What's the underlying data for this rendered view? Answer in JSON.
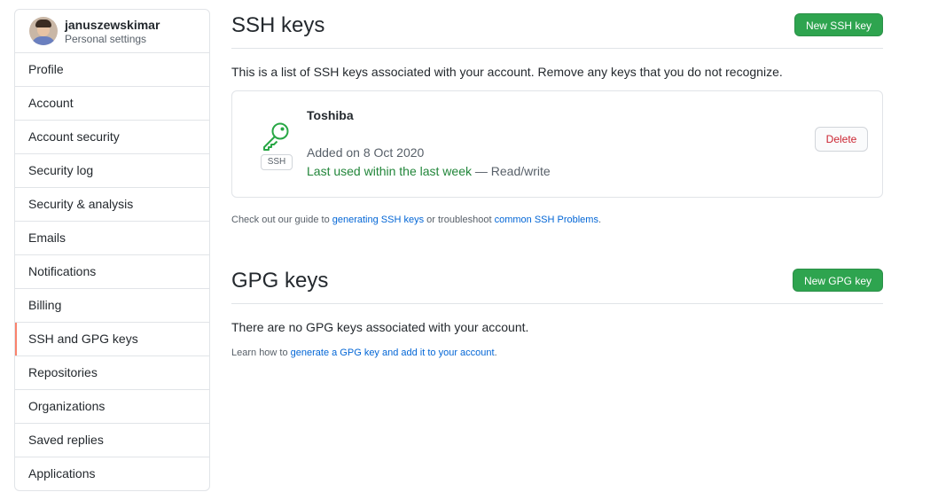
{
  "user": {
    "username": "januszewskimar",
    "subtitle": "Personal settings"
  },
  "sidebar": {
    "items": [
      {
        "label": "Profile"
      },
      {
        "label": "Account"
      },
      {
        "label": "Account security"
      },
      {
        "label": "Security log"
      },
      {
        "label": "Security & analysis"
      },
      {
        "label": "Emails"
      },
      {
        "label": "Notifications"
      },
      {
        "label": "Billing"
      },
      {
        "label": "SSH and GPG keys",
        "selected": true
      },
      {
        "label": "Repositories"
      },
      {
        "label": "Organizations"
      },
      {
        "label": "Saved replies"
      },
      {
        "label": "Applications"
      }
    ]
  },
  "ssh": {
    "title": "SSH keys",
    "new_button": "New SSH key",
    "description": "This is a list of SSH keys associated with your account. Remove any keys that you do not recognize.",
    "key": {
      "icon": "key-icon",
      "type_label": "SSH",
      "name": "Toshiba",
      "added": "Added on 8 Oct 2020",
      "last_used": "Last used within the last week",
      "access": " — Read/write",
      "delete_label": "Delete"
    },
    "guide_prefix": "Check out our guide to ",
    "guide_link": "generating SSH keys",
    "guide_middle": " or troubleshoot ",
    "guide_link2": "common SSH Problems",
    "guide_suffix": "."
  },
  "gpg": {
    "title": "GPG keys",
    "new_button": "New GPG key",
    "empty_text": "There are no GPG keys associated with your account.",
    "learn_prefix": "Learn how to ",
    "learn_link": "generate a GPG key and add it to your account",
    "learn_suffix": "."
  },
  "colors": {
    "accent_green": "#2ea44f",
    "selected_marker": "#f9826c",
    "link": "#0366d6",
    "danger": "#cb2431",
    "success_text": "#22863a"
  }
}
